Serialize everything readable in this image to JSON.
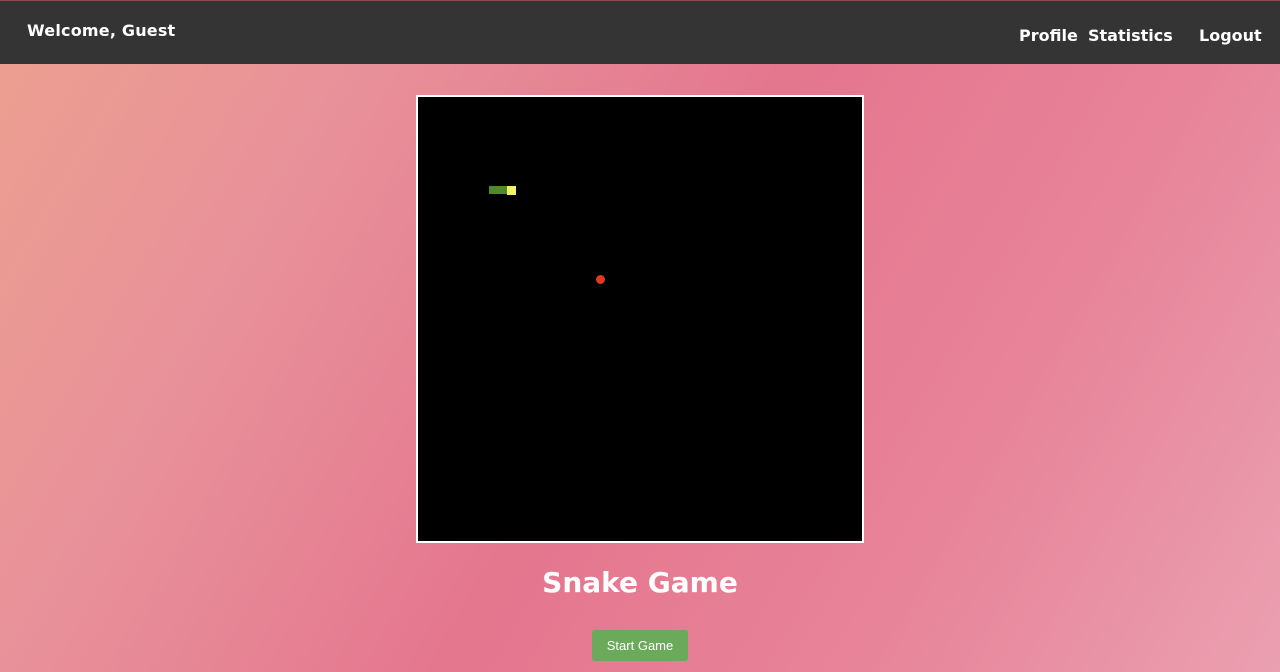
{
  "header": {
    "welcome_text": "Welcome, Guest",
    "nav": {
      "profile": "Profile",
      "statistics": "Statistics",
      "logout": "Logout"
    }
  },
  "game": {
    "title": "Snake Game",
    "start_button": "Start Game",
    "colors": {
      "board": "#000000",
      "snake_body": "#4e8a2c",
      "snake_head": "#f2f26a",
      "food": "#e03a1a"
    }
  }
}
